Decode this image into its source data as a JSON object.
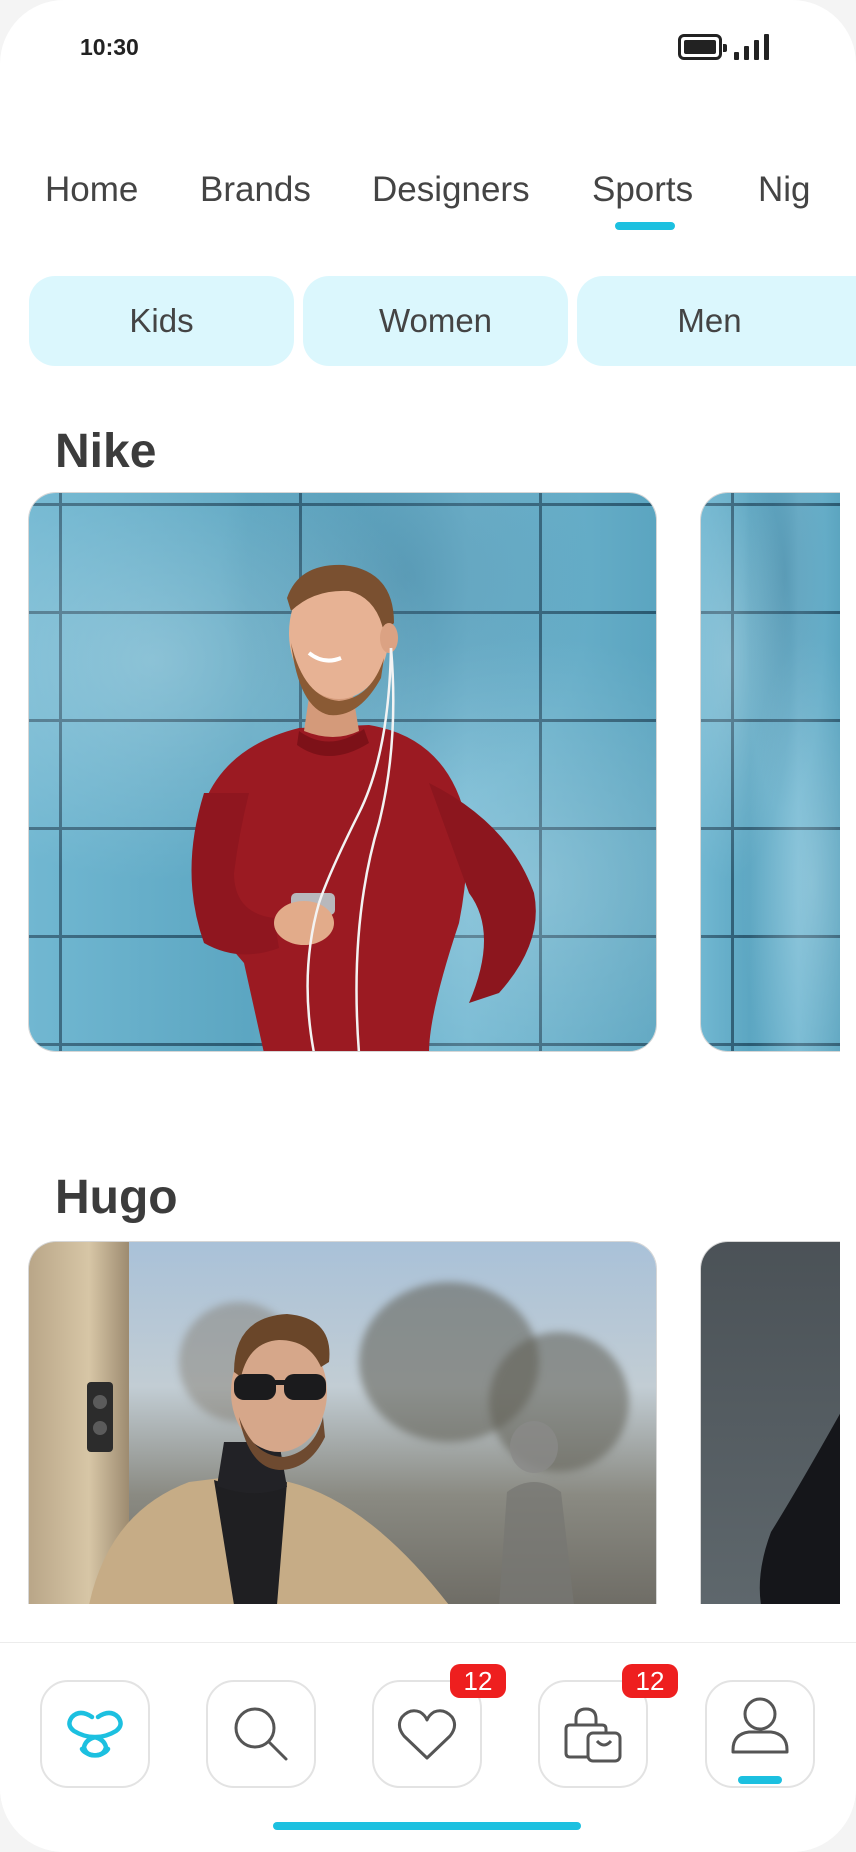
{
  "status_bar": {
    "time": "10:30"
  },
  "tabs": [
    "Home",
    "Brands",
    "Designers",
    "Sports",
    "Nig"
  ],
  "active_tab": "Sports",
  "chips": [
    "Kids",
    "Women",
    "Men"
  ],
  "sections": [
    {
      "title": "Nike"
    },
    {
      "title": "Hugo"
    }
  ],
  "bottom_nav": {
    "items": [
      "logo-icon",
      "search-icon",
      "heart-icon",
      "bag-icon",
      "profile-icon"
    ],
    "favorites_badge": "12",
    "bag_badge": "12",
    "active": "profile-icon"
  },
  "colors": {
    "accent": "#1cc0e0",
    "chip_bg": "#dbf7fd",
    "badge": "#ee1f1f"
  }
}
